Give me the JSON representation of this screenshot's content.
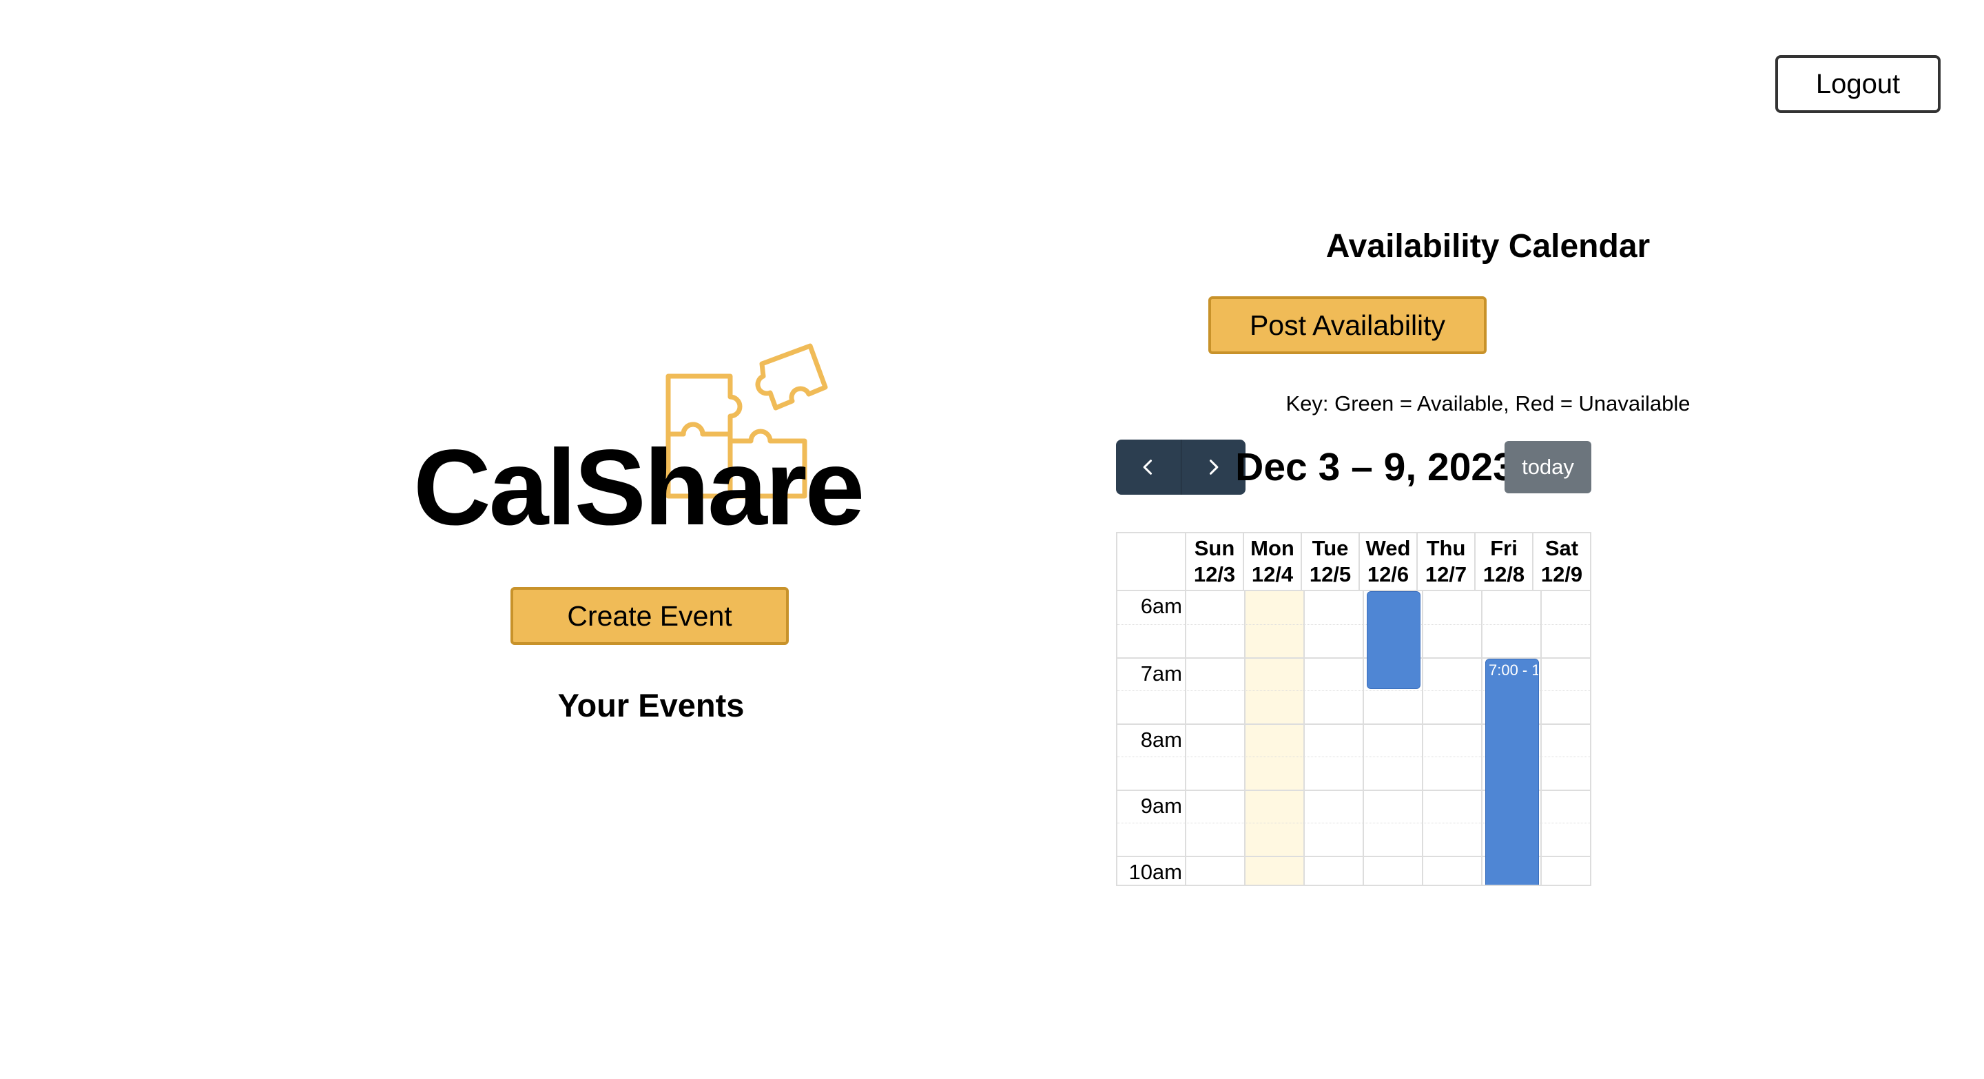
{
  "header": {
    "logout_label": "Logout"
  },
  "logo": {
    "text": "CalShare",
    "icon": "puzzle-pieces-icon",
    "icon_color": "#f0bb57"
  },
  "left": {
    "create_event_label": "Create Event",
    "your_events_title": "Your Events"
  },
  "availability": {
    "title": "Availability Calendar",
    "post_label": "Post Availability",
    "key_text": "Key: Green = Available, Red = Unavailable"
  },
  "calendar": {
    "prev_icon": "chevron-left-icon",
    "next_icon": "chevron-right-icon",
    "title": "Dec 3 – 9, 2023",
    "today_label": "today",
    "days": [
      {
        "name": "Sun",
        "date": "12/3"
      },
      {
        "name": "Mon",
        "date": "12/4"
      },
      {
        "name": "Tue",
        "date": "12/5"
      },
      {
        "name": "Wed",
        "date": "12/6"
      },
      {
        "name": "Thu",
        "date": "12/7"
      },
      {
        "name": "Fri",
        "date": "12/8"
      },
      {
        "name": "Sat",
        "date": "12/9"
      }
    ],
    "times": [
      "6am",
      "7am",
      "8am",
      "9am",
      "10am"
    ],
    "events": [
      {
        "day": "Wed",
        "label": ""
      },
      {
        "day": "Fri",
        "label": "7:00 - 1"
      }
    ],
    "colors": {
      "accent": "#f0bb57",
      "toolbar": "#2c3e50",
      "today_button": "#6c757d",
      "event": "#4f86d4",
      "today_highlight": "#fff8e1"
    }
  }
}
